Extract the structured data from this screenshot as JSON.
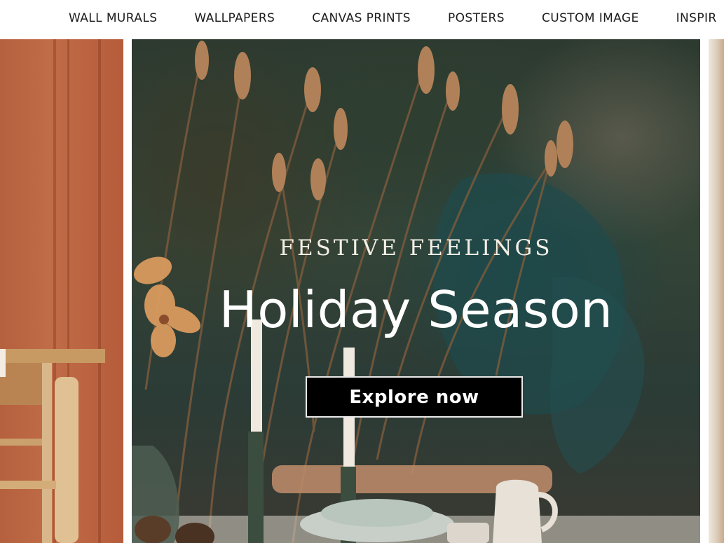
{
  "nav": {
    "items": [
      {
        "label": "WALL MURALS"
      },
      {
        "label": "WALLPAPERS"
      },
      {
        "label": "CANVAS PRINTS"
      },
      {
        "label": "POSTERS"
      },
      {
        "label": "CUSTOM IMAGE"
      },
      {
        "label": "INSPIR"
      }
    ]
  },
  "hero": {
    "eyebrow": "FESTIVE FEELINGS",
    "headline": "Holiday Season",
    "cta_label": "Explore now"
  },
  "colors": {
    "cta_background": "#000000",
    "text": "#ffffff",
    "left_slide": "#bb6442",
    "main_slide": "#2f3d33"
  }
}
